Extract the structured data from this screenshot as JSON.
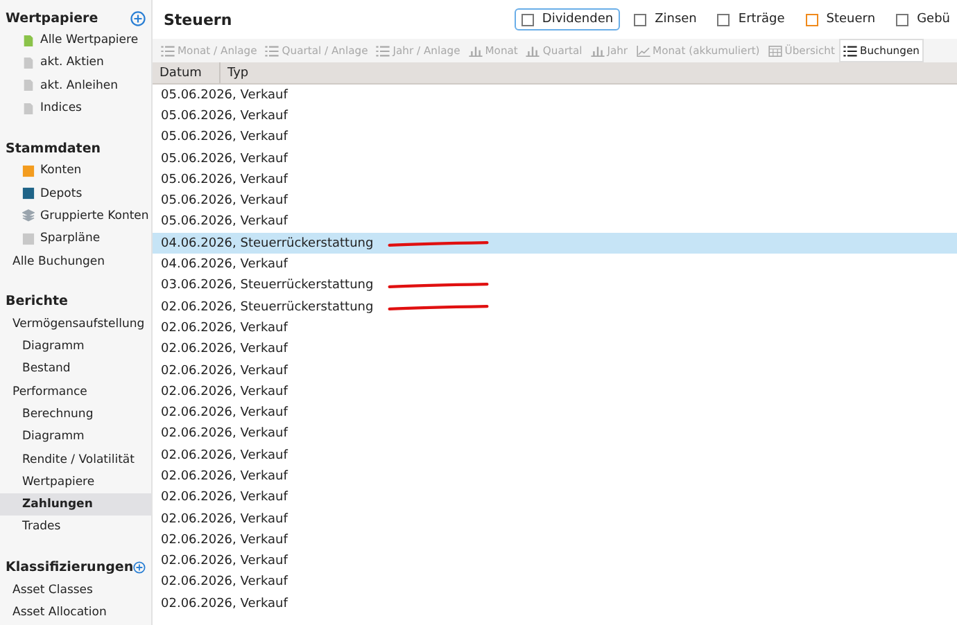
{
  "sidebar": {
    "sections": [
      {
        "title": "Wertpapiere",
        "add": true,
        "items": [
          {
            "label": "Alle Wertpapiere",
            "kind": "doc",
            "color": "#8bc34a",
            "selected": false
          },
          {
            "label": "akt. Aktien",
            "kind": "doc",
            "color": "#c8c8c8",
            "selected": false
          },
          {
            "label": "akt. Anleihen",
            "kind": "doc",
            "color": "#c8c8c8",
            "selected": false
          },
          {
            "label": "Indices",
            "kind": "doc",
            "color": "#c8c8c8",
            "selected": false
          }
        ]
      },
      {
        "title": "Stammdaten",
        "add": false,
        "items": [
          {
            "label": "Konten",
            "kind": "square",
            "color": "#f39c1f",
            "selected": false
          },
          {
            "label": "Depots",
            "kind": "square",
            "color": "#1f6488",
            "selected": false
          },
          {
            "label": "Gruppierte Konten",
            "kind": "layers",
            "color": "#9aa4ad",
            "selected": false
          },
          {
            "label": "Sparpläne",
            "kind": "square",
            "color": "#c8c8c8",
            "selected": false
          },
          {
            "label": "Alle Buchungen",
            "kind": "plain",
            "selected": false
          }
        ]
      },
      {
        "title": "Berichte",
        "add": false,
        "items": [
          {
            "label": "Vermögensaufstellung",
            "kind": "plain",
            "selected": false,
            "children": [
              {
                "label": "Diagramm",
                "selected": false
              },
              {
                "label": "Bestand",
                "selected": false
              }
            ]
          },
          {
            "label": "Performance",
            "kind": "plain",
            "selected": false,
            "children": [
              {
                "label": "Berechnung",
                "selected": false
              },
              {
                "label": "Diagramm",
                "selected": false
              },
              {
                "label": "Rendite / Volatilität",
                "selected": false
              },
              {
                "label": "Wertpapiere",
                "selected": false
              },
              {
                "label": "Zahlungen",
                "selected": true
              },
              {
                "label": "Trades",
                "selected": false
              }
            ]
          }
        ]
      },
      {
        "title": "Klassifizierungen",
        "add": true,
        "items": [
          {
            "label": "Asset Classes",
            "kind": "plain",
            "selected": false
          },
          {
            "label": "Asset Allocation",
            "kind": "plain",
            "selected": false
          }
        ]
      }
    ]
  },
  "header": {
    "title": "Steuern",
    "filters": [
      {
        "label": "Dividenden",
        "checked": false,
        "focused": true
      },
      {
        "label": "Zinsen",
        "checked": false,
        "focused": false
      },
      {
        "label": "Erträge",
        "checked": false,
        "focused": false
      },
      {
        "label": "Steuern",
        "checked": true,
        "focused": false
      },
      {
        "label": "Gebü",
        "checked": false,
        "focused": false
      }
    ]
  },
  "toolbar": [
    {
      "label": "Monat / Anlage",
      "kind": "list",
      "selected": false
    },
    {
      "label": "Quartal / Anlage",
      "kind": "list",
      "selected": false
    },
    {
      "label": "Jahr / Anlage",
      "kind": "list",
      "selected": false
    },
    {
      "label": "Monat",
      "kind": "bar",
      "selected": false
    },
    {
      "label": "Quartal",
      "kind": "bar",
      "selected": false
    },
    {
      "label": "Jahr",
      "kind": "bar",
      "selected": false
    },
    {
      "label": "Monat (akkumuliert)",
      "kind": "line",
      "selected": false
    },
    {
      "label": "Übersicht",
      "kind": "calendar",
      "selected": false
    },
    {
      "label": "Buchungen",
      "kind": "list",
      "selected": true
    }
  ],
  "table": {
    "columns": [
      "Datum",
      "Typ"
    ],
    "rows": [
      {
        "text": "05.06.2026, Verkauf",
        "selected": false,
        "marked": false
      },
      {
        "text": "05.06.2026, Verkauf",
        "selected": false,
        "marked": false
      },
      {
        "text": "05.06.2026, Verkauf",
        "selected": false,
        "marked": false
      },
      {
        "text": "05.06.2026, Verkauf",
        "selected": false,
        "marked": false
      },
      {
        "text": "05.06.2026, Verkauf",
        "selected": false,
        "marked": false
      },
      {
        "text": "05.06.2026, Verkauf",
        "selected": false,
        "marked": false
      },
      {
        "text": "05.06.2026, Verkauf",
        "selected": false,
        "marked": false
      },
      {
        "text": "04.06.2026, Steuerrückerstattung",
        "selected": true,
        "marked": true
      },
      {
        "text": "04.06.2026, Verkauf",
        "selected": false,
        "marked": false
      },
      {
        "text": "03.06.2026, Steuerrückerstattung",
        "selected": false,
        "marked": true
      },
      {
        "text": "02.06.2026, Steuerrückerstattung",
        "selected": false,
        "marked": true
      },
      {
        "text": "02.06.2026, Verkauf",
        "selected": false,
        "marked": false
      },
      {
        "text": "02.06.2026, Verkauf",
        "selected": false,
        "marked": false
      },
      {
        "text": "02.06.2026, Verkauf",
        "selected": false,
        "marked": false
      },
      {
        "text": "02.06.2026, Verkauf",
        "selected": false,
        "marked": false
      },
      {
        "text": "02.06.2026, Verkauf",
        "selected": false,
        "marked": false
      },
      {
        "text": "02.06.2026, Verkauf",
        "selected": false,
        "marked": false
      },
      {
        "text": "02.06.2026, Verkauf",
        "selected": false,
        "marked": false
      },
      {
        "text": "02.06.2026, Verkauf",
        "selected": false,
        "marked": false
      },
      {
        "text": "02.06.2026, Verkauf",
        "selected": false,
        "marked": false
      },
      {
        "text": "02.06.2026, Verkauf",
        "selected": false,
        "marked": false
      },
      {
        "text": "02.06.2026, Verkauf",
        "selected": false,
        "marked": false
      },
      {
        "text": "02.06.2026, Verkauf",
        "selected": false,
        "marked": false
      },
      {
        "text": "02.06.2026, Verkauf",
        "selected": false,
        "marked": false
      },
      {
        "text": "02.06.2026, Verkauf",
        "selected": false,
        "marked": false
      }
    ]
  }
}
